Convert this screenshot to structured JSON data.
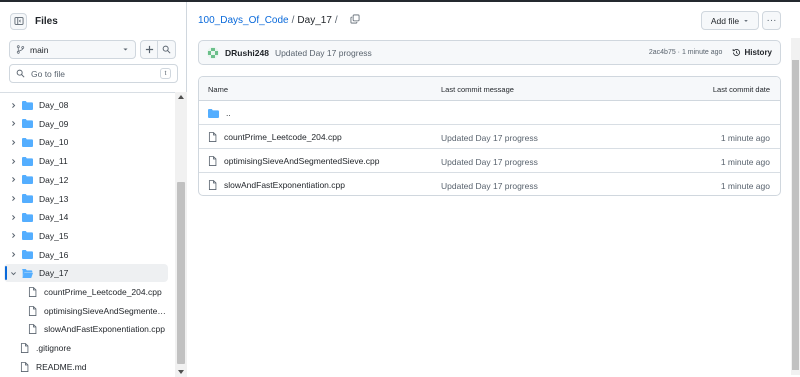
{
  "sidebar": {
    "title": "Files",
    "branch": "main",
    "search_placeholder": "Go to file",
    "search_shortcut": "t",
    "tree": [
      {
        "label": "Day_08",
        "type": "folder",
        "expanded": false,
        "depth": 0
      },
      {
        "label": "Day_09",
        "type": "folder",
        "expanded": false,
        "depth": 0
      },
      {
        "label": "Day_10",
        "type": "folder",
        "expanded": false,
        "depth": 0
      },
      {
        "label": "Day_11",
        "type": "folder",
        "expanded": false,
        "depth": 0
      },
      {
        "label": "Day_12",
        "type": "folder",
        "expanded": false,
        "depth": 0
      },
      {
        "label": "Day_13",
        "type": "folder",
        "expanded": false,
        "depth": 0
      },
      {
        "label": "Day_14",
        "type": "folder",
        "expanded": false,
        "depth": 0
      },
      {
        "label": "Day_15",
        "type": "folder",
        "expanded": false,
        "depth": 0
      },
      {
        "label": "Day_16",
        "type": "folder",
        "expanded": false,
        "depth": 0
      },
      {
        "label": "Day_17",
        "type": "folder",
        "expanded": true,
        "depth": 0,
        "selected": true
      },
      {
        "label": "countPrime_Leetcode_204.cpp",
        "type": "file",
        "depth": 1
      },
      {
        "label": "optimisingSieveAndSegmented…",
        "type": "file",
        "depth": 1
      },
      {
        "label": "slowAndFastExponentiation.cpp",
        "type": "file",
        "depth": 1
      },
      {
        "label": ".gitignore",
        "type": "file",
        "depth": 0
      },
      {
        "label": "README.md",
        "type": "file",
        "depth": 0
      }
    ]
  },
  "breadcrumb": {
    "repo": "100_Days_Of_Code",
    "sep1": "/",
    "current": "Day_17",
    "sep2": "/"
  },
  "toolbar": {
    "add_file": "Add file",
    "more": "···"
  },
  "commit": {
    "user": "DRushi248",
    "message": "Updated Day 17 progress",
    "meta": "2ac4b75 · 1 minute ago",
    "history": "History"
  },
  "table": {
    "headers": {
      "name": "Name",
      "message": "Last commit message",
      "date": "Last commit date"
    },
    "parent": "..",
    "rows": [
      {
        "name": "countPrime_Leetcode_204.cpp",
        "message": "Updated Day 17 progress",
        "date": "1 minute ago"
      },
      {
        "name": "optimisingSieveAndSegmentedSieve.cpp",
        "message": "Updated Day 17 progress",
        "date": "1 minute ago"
      },
      {
        "name": "slowAndFastExponentiation.cpp",
        "message": "Updated Day 17 progress",
        "date": "1 minute ago"
      }
    ]
  },
  "colors": {
    "accent": "#0969da",
    "folder": "#54aeff",
    "border": "#d0d7de"
  }
}
